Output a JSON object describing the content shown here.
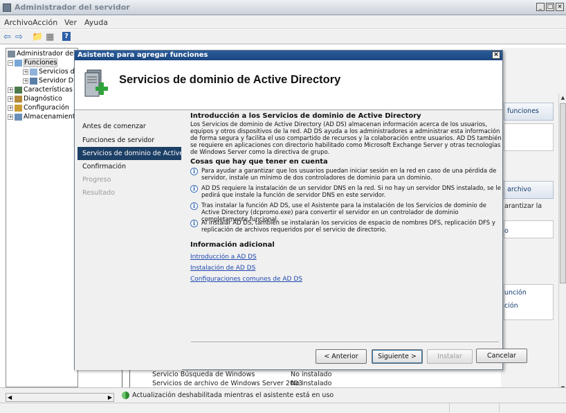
{
  "server_manager": {
    "title": "Administrador del servidor",
    "menu": [
      "Archivo",
      "Acción",
      "Ver",
      "Ayuda"
    ],
    "tree": [
      {
        "label": "Administrador del s",
        "indent": 0,
        "expander": "",
        "selected": false
      },
      {
        "label": "Funciones",
        "indent": 1,
        "expander": "−",
        "selected": true
      },
      {
        "label": "Servicios de",
        "indent": 2,
        "expander": "+",
        "selected": false
      },
      {
        "label": "Servidor DH",
        "indent": 2,
        "expander": "+",
        "selected": false
      },
      {
        "label": "Características",
        "indent": 1,
        "expander": "+",
        "selected": false
      },
      {
        "label": "Diagnóstico",
        "indent": 1,
        "expander": "+",
        "selected": false
      },
      {
        "label": "Configuración",
        "indent": 1,
        "expander": "+",
        "selected": false
      },
      {
        "label": "Almacenamiento",
        "indent": 1,
        "expander": "+",
        "selected": false
      }
    ],
    "right_panel": {
      "header1": "funciones",
      "header2": "archivo",
      "text1": "arantizar la",
      "link1": "o",
      "link2": "unción",
      "link3": "ción"
    },
    "bg_rows": [
      {
        "name": "Servicio Búsqueda de Windows",
        "status": "No instalado"
      },
      {
        "name": "Servicios de archivo de Windows Server 2003",
        "status": "No instalado"
      }
    ],
    "status_message": "Actualización deshabilitada mientras el asistente está en uso"
  },
  "wizard": {
    "title": "Asistente para agregar funciones",
    "header_title": "Servicios de dominio de Active Directory",
    "nav": [
      {
        "label": "Antes de comenzar",
        "state": "normal"
      },
      {
        "label": "Funciones de servidor",
        "state": "normal"
      },
      {
        "label": "Servicios de dominio de Active Dir...",
        "state": "active"
      },
      {
        "label": "Confirmación",
        "state": "normal"
      },
      {
        "label": "Progreso",
        "state": "disabled"
      },
      {
        "label": "Resultado",
        "state": "disabled"
      }
    ],
    "intro_heading": "Introducción a los Servicios de dominio de Active Directory",
    "intro_text": "Los Servicios de dominio de Active Directory (AD DS) almacenan información acerca de los usuarios, equipos y otros dispositivos de la red. AD DS ayuda a los administradores a administrar esta información de forma segura y facilita el uso compartido de recursos y la colaboración entre usuarios. AD DS también se requiere en aplicaciones con directorio habilitado como Microsoft Exchange Server y otras tecnologías de Windows Server como la directiva de grupo.",
    "notes_heading": "Cosas que hay que tener en cuenta",
    "notes": [
      "Para ayudar a garantizar que los usuarios puedan iniciar sesión en la red en caso de una pérdida de servidor, instale un mínimo de dos controladores de dominio para un dominio.",
      "AD DS requiere la instalación de un servidor DNS en la red. Si no hay un servidor DNS instalado, se le pedirá que instale la función de servidor DNS en este servidor.",
      "Tras instalar la función AD DS, use el Asistente para la instalación de los Servicios de dominio de Active Directory (dcpromo.exe) para convertir el servidor en un controlador de dominio completamente funcional.",
      "Al instalar AD DS, también se instalarán los servicios de espacio de nombres DFS, replicación DFS y replicación de archivos requeridos por el servicio de directorio."
    ],
    "more_heading": "Información adicional",
    "links": [
      "Introducción a AD DS",
      "Instalación de AD DS",
      "Configuraciones comunes de AD DS"
    ],
    "buttons": {
      "back": "< Anterior",
      "next": "Siguiente >",
      "install": "Instalar",
      "cancel": "Cancelar"
    }
  }
}
